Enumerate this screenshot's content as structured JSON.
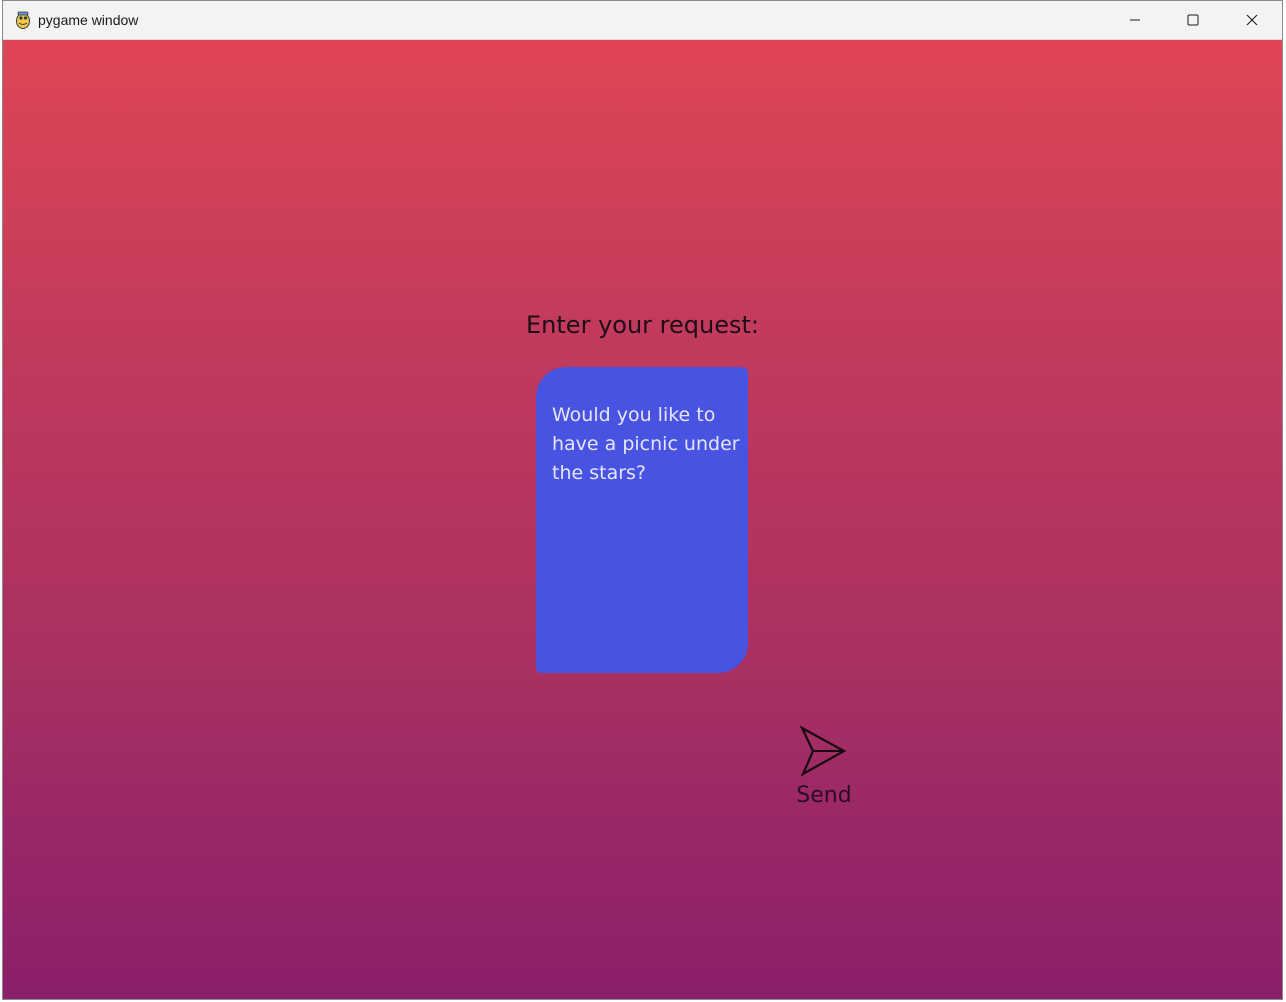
{
  "window": {
    "title": "pygame window",
    "app_icon": "pygame-snake-icon"
  },
  "controls": {
    "minimize_icon": "minimize-icon",
    "maximize_icon": "maximize-icon",
    "close_icon": "close-icon"
  },
  "main": {
    "prompt_label": "Enter your request:",
    "request_text": "Would you like to\nhave a picnic under\nthe stars?",
    "send_icon": "paper-plane-icon",
    "send_label": "Send"
  },
  "colors": {
    "gradient_top": "#e04556",
    "gradient_bottom": "#8a1f6a",
    "text_box": "#4853e1",
    "text_box_text": "#e5e6fb"
  }
}
